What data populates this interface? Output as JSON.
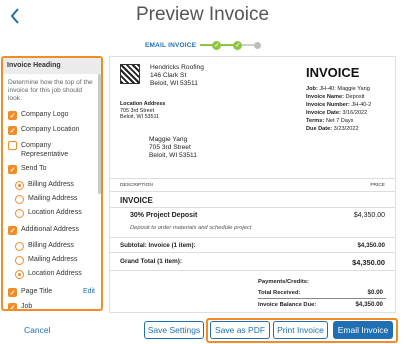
{
  "header": {
    "title": "Preview Invoice"
  },
  "stepper": {
    "label": "EMAIL INVOICE",
    "step1": "✓",
    "step2": "✓"
  },
  "sidebar": {
    "heading": "Invoice Heading",
    "description": "Determine how the top of the invoice for this job should look.",
    "options": {
      "company_logo": "Company Logo",
      "company_location": "Company Location",
      "company_rep": "Company Representative",
      "send_to": "Send To",
      "billing_address": "Billing Address",
      "mailing_address": "Mailing Address",
      "location_address": "Location Address",
      "additional_address": "Additional Address",
      "add_billing_address": "Billing Address",
      "add_mailing_address": "Mailing Address",
      "add_location_address": "Location Address",
      "page_title": "Page Title",
      "job": "Job"
    },
    "edit_label": "Edit"
  },
  "invoice": {
    "company_name": "Hendricks Roofing",
    "company_street": "146 Clark St",
    "company_city": "Beloit, WI 53511",
    "title": "INVOICE",
    "meta": {
      "job_label": "Job:",
      "job_value": "JH-40: Maggie Yang",
      "name_label": "Invoice Name:",
      "name_value": "Deposit",
      "number_label": "Invoice Number:",
      "number_value": "JH-40-2",
      "date_label": "Invoice Date:",
      "date_value": "3/16/2022",
      "terms_label": "Terms:",
      "terms_value": "Net 7 Days",
      "due_label": "Due Date:",
      "due_value": "3/23/2022"
    },
    "location_label": "Location Address",
    "location_street": "705 3rd Street",
    "location_city": "Beloit, WI 53511",
    "bill_name": "Maggie Yang",
    "bill_street": "705 3rd Street",
    "bill_city": "Beloit, WI 53511",
    "col_description": "DESCRIPTION",
    "col_price": "PRICE",
    "section": "INVOICE",
    "item_name": "30% Project Deposit",
    "item_price": "$4,350.00",
    "item_note": "Deposit to order materials and schedule project",
    "subtotal_label": "Subtotal: Invoice (1 item):",
    "subtotal_value": "$4,350.00",
    "grand_label": "Grand Total (1 item):",
    "grand_value": "$4,350.00",
    "payments_label": "Payments/Credits:",
    "received_label": "Total Received:",
    "received_value": "$0.00",
    "balance_label": "Invoice Balance Due:",
    "balance_value": "$4,350.00"
  },
  "footer": {
    "cancel": "Cancel",
    "save_settings": "Save Settings",
    "save_pdf": "Save as PDF",
    "print_invoice": "Print Invoice",
    "email_invoice": "Email Invoice"
  },
  "colors": {
    "accent": "#1f6fb2",
    "highlight": "#f28c28",
    "step_done": "#8cc63f"
  }
}
